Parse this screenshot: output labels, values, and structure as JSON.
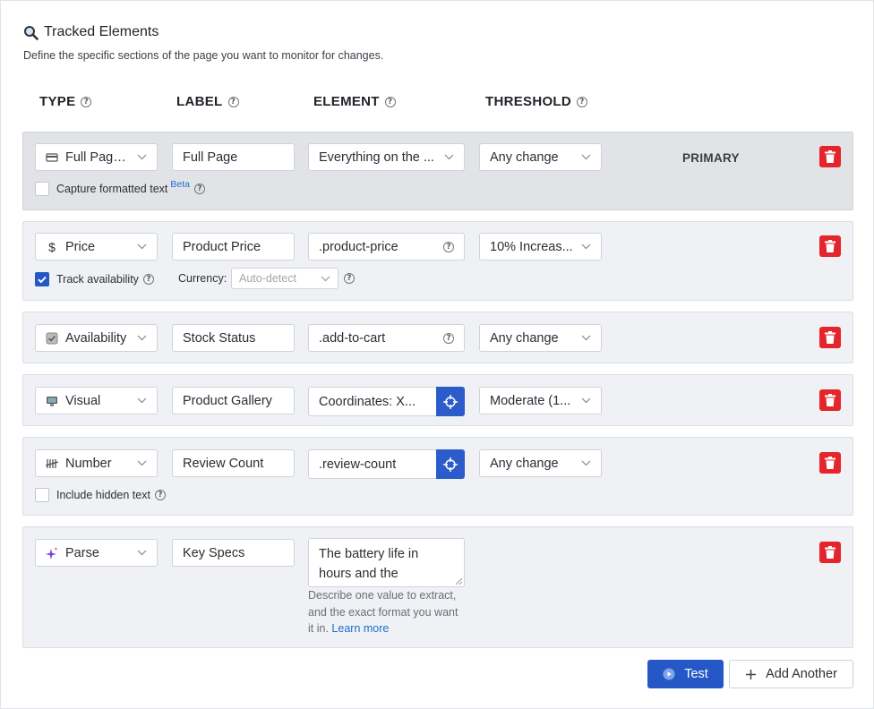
{
  "section": {
    "title": "Tracked Elements",
    "description": "Define the specific sections of the page you want to monitor for changes."
  },
  "columns": {
    "type": "TYPE",
    "label": "LABEL",
    "element": "ELEMENT",
    "threshold": "THRESHOLD",
    "help": "?"
  },
  "rows": [
    {
      "type": "Full Page ...",
      "type_icon": "card-icon",
      "label": "Full Page",
      "element": "Everything on the ...",
      "threshold": "Any change",
      "primary_badge": "PRIMARY",
      "option_label": "Capture formatted text",
      "option_checked": false,
      "beta": "Beta"
    },
    {
      "type": "Price",
      "type_icon": "dollar-icon",
      "label": "Product Price",
      "element": ".product-price",
      "threshold": "10% Increas...",
      "option_label": "Track availability",
      "option_checked": true,
      "currency_label": "Currency:",
      "currency_placeholder": "Auto-detect"
    },
    {
      "type": "Availability",
      "type_icon": "checkbox-icon",
      "label": "Stock Status",
      "element": ".add-to-cart",
      "threshold": "Any change"
    },
    {
      "type": "Visual",
      "type_icon": "monitor-icon",
      "label": "Product Gallery",
      "element": "Coordinates: X...",
      "threshold": "Moderate (1..."
    },
    {
      "type": "Number",
      "type_icon": "tally-icon",
      "label": "Review Count",
      "element": ".review-count",
      "threshold": "Any change",
      "option_label": "Include hidden text",
      "option_checked": false
    },
    {
      "type": "Parse",
      "type_icon": "sparkle-icon",
      "label": "Key Specs",
      "element_lines": [
        "The battery life in",
        "hours and the"
      ],
      "hint_lines": [
        "Describe one value to extract,",
        "and the exact format you want"
      ],
      "hint_last": "it in.",
      "learn_more": "Learn more"
    }
  ],
  "actions": {
    "test": "Test",
    "add_another": "Add Another"
  },
  "colors": {
    "accent": "#2558c6",
    "danger": "#e4262c",
    "link": "#1a6fd1"
  }
}
